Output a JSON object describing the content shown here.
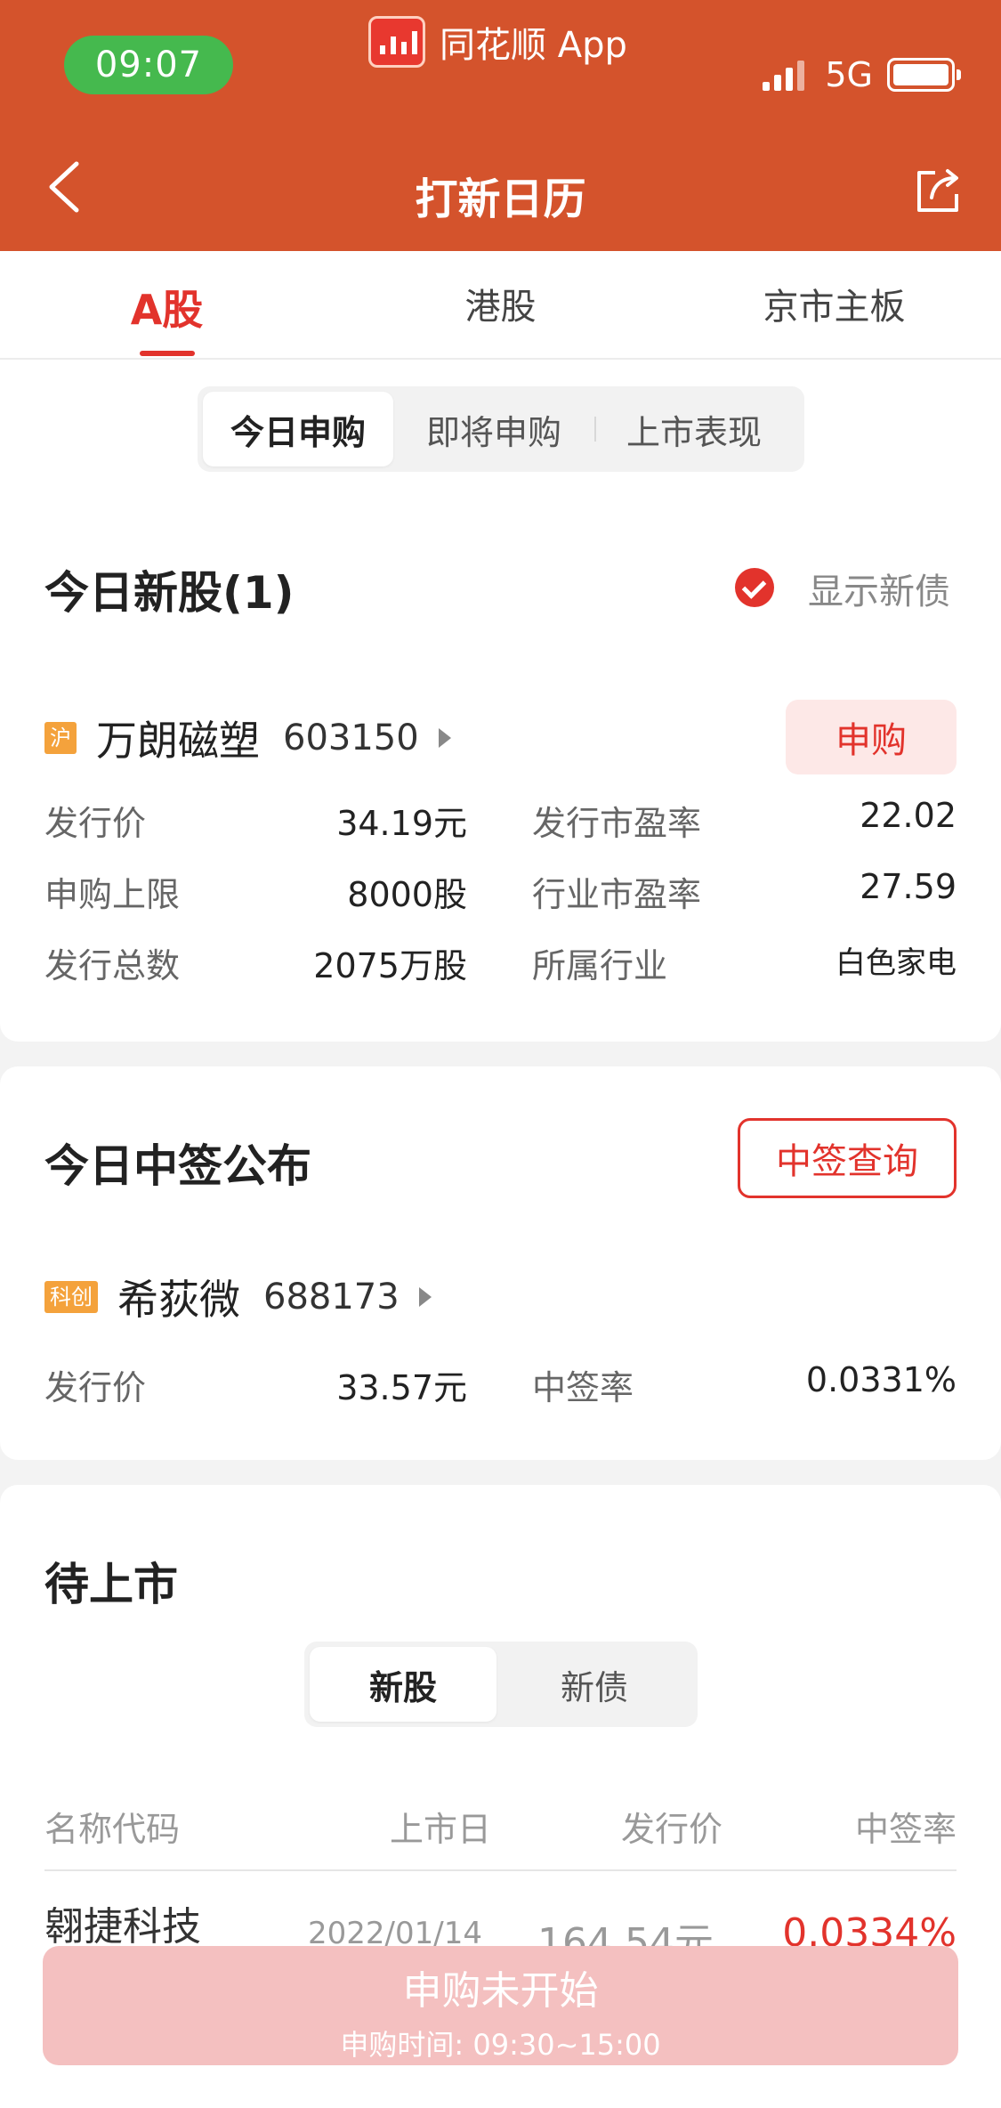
{
  "status_bar": {
    "time": "09:07",
    "app_name": "同花顺 App",
    "network": "5G"
  },
  "nav": {
    "title": "打新日历"
  },
  "market_tabs": [
    {
      "label": "A股",
      "active": true
    },
    {
      "label": "港股",
      "active": false
    },
    {
      "label": "京市主板",
      "active": false
    }
  ],
  "segment": [
    "今日申购",
    "即将申购",
    "上市表现"
  ],
  "today_new": {
    "title": "今日新股(1)",
    "show_bonds_label": "显示新债",
    "stock": {
      "badge": "沪",
      "name": "万朗磁塑",
      "code": "603150",
      "button": "申购",
      "fields": [
        {
          "label": "发行价",
          "value": "34.19元"
        },
        {
          "label": "发行市盈率",
          "value": "22.02"
        },
        {
          "label": "申购上限",
          "value": "8000股"
        },
        {
          "label": "行业市盈率",
          "value": "27.59"
        },
        {
          "label": "发行总数",
          "value": "2075万股"
        },
        {
          "label": "所属行业",
          "value": "白色家电"
        }
      ]
    }
  },
  "lottery": {
    "title": "今日中签公布",
    "button": "中签查询",
    "stock": {
      "badge": "科创",
      "name": "希荻微",
      "code": "688173",
      "fields": [
        {
          "label": "发行价",
          "value": "33.57元"
        },
        {
          "label": "中签率",
          "value": "0.0331%"
        }
      ]
    }
  },
  "upcoming": {
    "title": "待上市",
    "tabs": [
      "新股",
      "新债"
    ],
    "columns": [
      "名称代码",
      "上市日",
      "发行价",
      "中签率"
    ],
    "partial_row": {
      "name": "翱捷科技",
      "date": "2022/01/14",
      "price": "164.54元",
      "rate": "0.0334%"
    }
  },
  "bottom_button": {
    "title": "申购未开始",
    "subtitle": "申购时间: 09:30~15:00"
  },
  "colors": {
    "header": "#d4532c",
    "accent": "#e2332c",
    "time_pill": "#45b94e",
    "badge": "#f4a23c"
  }
}
